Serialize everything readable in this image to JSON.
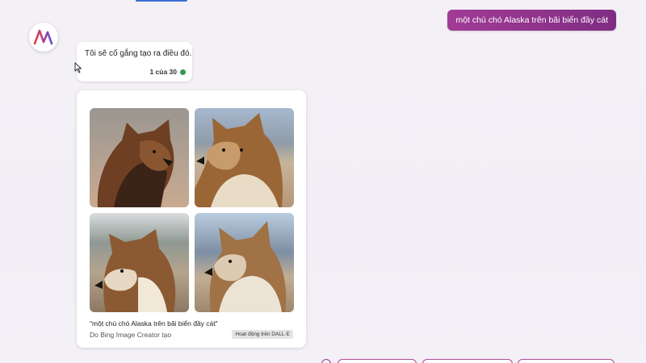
{
  "user_message": "một chú chó Alaska trên bãi biển đầy cát",
  "bot_message": {
    "text": "Tôi sẽ cố gắng tạo ra điều đó.",
    "turn_counter": "1 của 30"
  },
  "image_card": {
    "caption": "\"một chú chó Alaska trên bãi biển đầy cát\"",
    "credit": "Do Bing Image Creator tạo",
    "badge": "Hoạt động trên DALL·E"
  },
  "colors": {
    "accent": "#8f3189",
    "status_online": "#2f9a4f"
  }
}
